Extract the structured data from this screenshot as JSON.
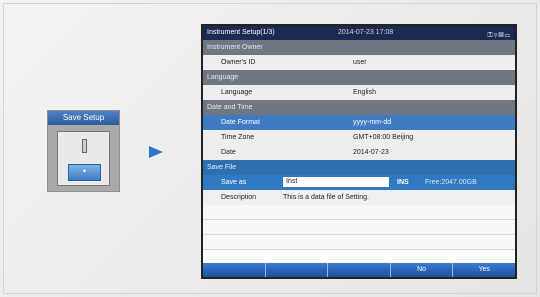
{
  "save_panel": {
    "header": "Save Setup"
  },
  "screen": {
    "title": "Instrument Setup(1/3)",
    "datetime": "2014-07-23 17:08",
    "status_icons": [
      "key-icon",
      "usb-icon",
      "sd-card-icon",
      "battery-icon"
    ],
    "sections": {
      "owner": "Instrument Owner",
      "language": "Language",
      "datetime": "Date and Time",
      "save": "Save File"
    },
    "fields": {
      "owners_id": {
        "label": "Owner's ID",
        "value": "user"
      },
      "language": {
        "label": "Language",
        "value": "English"
      },
      "date_format": {
        "label": "Date Format",
        "value": "yyyy-mm-dd"
      },
      "time_zone": {
        "label": "Time Zone",
        "value": "GMT+08:00 Beijing"
      },
      "date": {
        "label": "Date",
        "value": "2014-07-23"
      },
      "save_as": {
        "label": "Save as",
        "value": "Inst",
        "ins": "INS",
        "free": "Free:2047.00GB"
      },
      "description": {
        "label": "Description",
        "value": "This is a data file of Setting."
      }
    },
    "softkeys": [
      "",
      "",
      "",
      "No",
      "Yes"
    ]
  },
  "colors": {
    "accent": "#2f79c3",
    "title_bar": "#1b2a50",
    "arrow": "#2e78c6"
  }
}
